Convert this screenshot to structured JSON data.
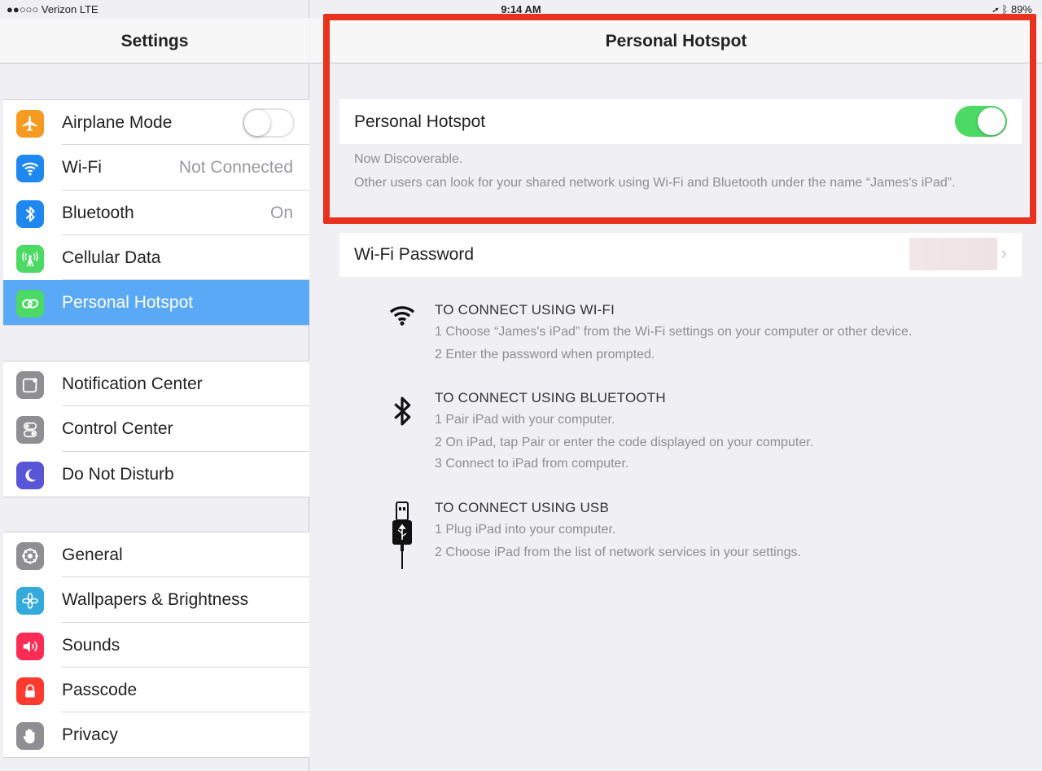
{
  "status_bar": {
    "carrier": "●●○○○ Verizon  LTE",
    "time": "9:14 AM",
    "battery": "89%"
  },
  "sidebar": {
    "title": "Settings",
    "groups": [
      [
        {
          "label": "Airplane Mode",
          "icon": "airplane-icon",
          "color": "#f59b21",
          "toggle": "off"
        },
        {
          "label": "Wi-Fi",
          "value": "Not Connected",
          "icon": "wifi-icon",
          "color": "#1e88f0"
        },
        {
          "label": "Bluetooth",
          "value": "On",
          "icon": "bluetooth-icon",
          "color": "#1e88f0"
        },
        {
          "label": "Cellular Data",
          "icon": "cellular-icon",
          "color": "#4cd964"
        },
        {
          "label": "Personal Hotspot",
          "icon": "hotspot-icon",
          "color": "#4cd964",
          "selected": true
        }
      ],
      [
        {
          "label": "Notification Center",
          "icon": "notification-icon",
          "color": "#8e8e93"
        },
        {
          "label": "Control Center",
          "icon": "control-center-icon",
          "color": "#8e8e93"
        },
        {
          "label": "Do Not Disturb",
          "icon": "moon-icon",
          "color": "#5856d6"
        }
      ],
      [
        {
          "label": "General",
          "icon": "gear-icon",
          "color": "#8e8e93"
        },
        {
          "label": "Wallpapers & Brightness",
          "icon": "wallpaper-icon",
          "color": "#34aadc"
        },
        {
          "label": "Sounds",
          "icon": "speaker-icon",
          "color": "#ff2d55"
        },
        {
          "label": "Passcode",
          "icon": "lock-icon",
          "color": "#ff3b30"
        },
        {
          "label": "Privacy",
          "icon": "hand-icon",
          "color": "#8e8e93"
        }
      ]
    ]
  },
  "detail": {
    "title": "Personal Hotspot",
    "hotspot_toggle": {
      "label": "Personal Hotspot",
      "state": "on"
    },
    "discoverable_note": "Now Discoverable.",
    "name_note": "Other users can look for your shared network using Wi-Fi and Bluetooth under the name “James's iPad”.",
    "wifi_password_label": "Wi-Fi Password",
    "instructions": [
      {
        "icon": "wifi-icon",
        "heading": "TO CONNECT USING WI-FI",
        "steps": [
          "1 Choose “James's iPad” from the Wi-Fi settings on your computer or other device.",
          "2 Enter the password when prompted."
        ]
      },
      {
        "icon": "bluetooth-icon",
        "heading": "TO CONNECT USING BLUETOOTH",
        "steps": [
          "1 Pair iPad with your computer.",
          "2 On iPad, tap Pair or enter the code displayed on your computer.",
          "3 Connect to iPad from computer."
        ]
      },
      {
        "icon": "usb-icon",
        "heading": "TO CONNECT USING USB",
        "steps": [
          "1 Plug iPad into your computer.",
          "2 Choose iPad from the list of network services in your settings."
        ]
      }
    ]
  },
  "highlight_color": "#e8321e"
}
